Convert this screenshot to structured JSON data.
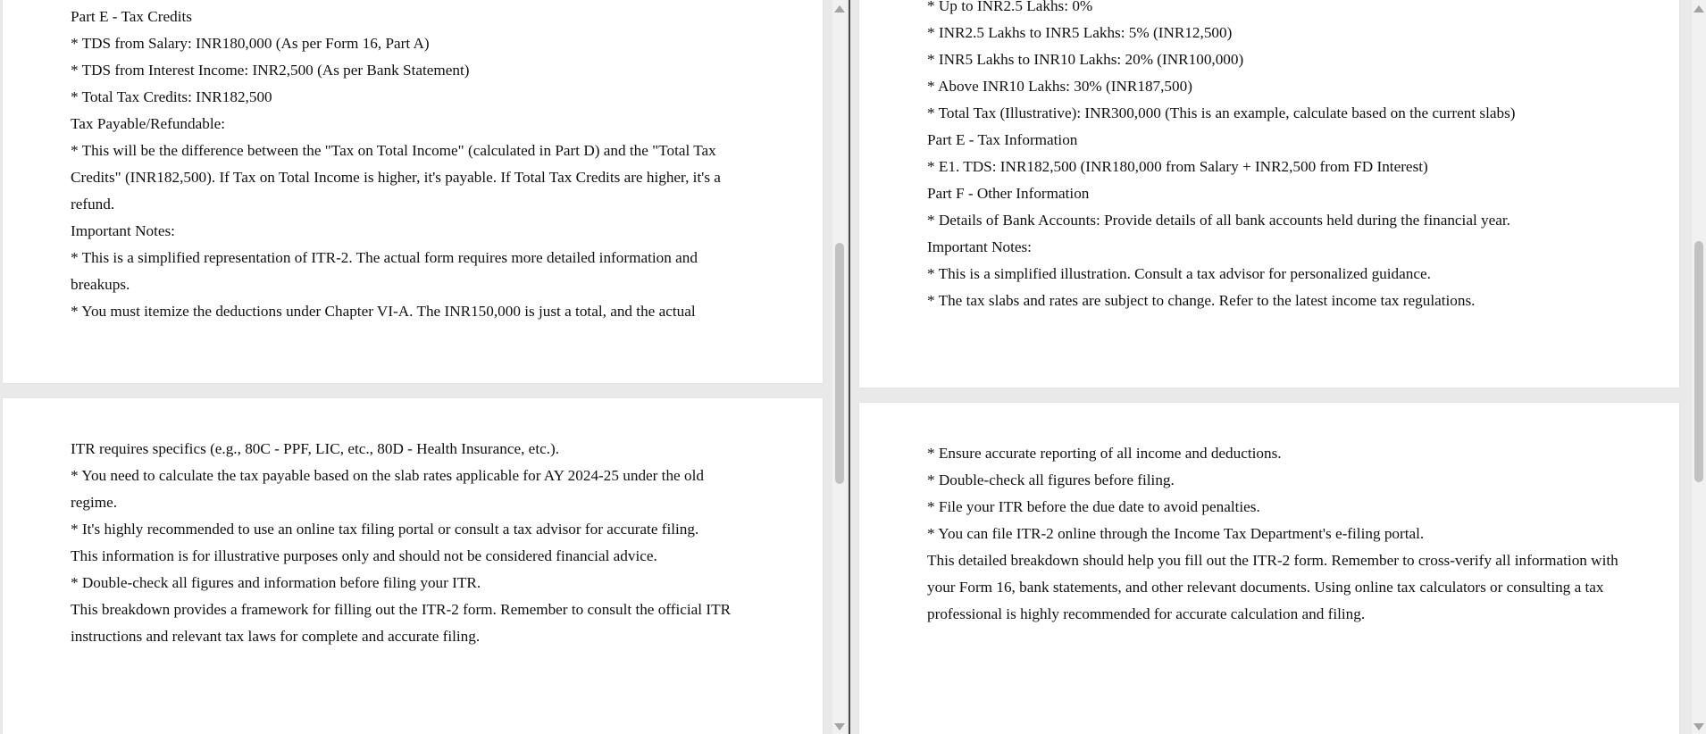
{
  "left_document": {
    "page1_lines": [
      "Part E - Tax Credits",
      "* TDS from Salary: INR180,000 (As per Form 16, Part A)",
      "* TDS from Interest Income: INR2,500 (As per Bank Statement)",
      "* Total Tax Credits: INR182,500",
      "Tax Payable/Refundable:",
      "* This will be the difference between the \"Tax on Total Income\" (calculated in Part D) and the \"Total Tax Credits\" (INR182,500). If Tax on Total Income is higher, it's payable. If Total Tax Credits are higher, it's a refund.",
      "Important Notes:",
      "* This is a simplified representation of ITR-2. The actual form requires more detailed information and breakups.",
      "* You must itemize the deductions under Chapter VI-A. The INR150,000 is just a total, and the actual"
    ],
    "page2_lines": [
      "ITR requires specifics (e.g., 80C - PPF, LIC, etc., 80D - Health Insurance, etc.).",
      "* You need to calculate the tax payable based on the slab rates applicable for AY 2024-25 under the old regime.",
      "* It's highly recommended to use an online tax filing portal or consult a tax advisor for accurate filing.",
      "This information is for illustrative purposes only and should not be considered financial advice.",
      "* Double-check all figures and information before filing your ITR.",
      "This breakdown provides a framework for filling out the ITR-2 form. Remember to consult the official ITR instructions and relevant tax laws for complete and accurate filing."
    ]
  },
  "right_document": {
    "page1_lines": [
      "* Up to INR2.5 Lakhs: 0%",
      "* INR2.5 Lakhs to INR5 Lakhs: 5% (INR12,500)",
      "* INR5 Lakhs to INR10 Lakhs: 20% (INR100,000)",
      "* Above INR10 Lakhs: 30% (INR187,500)",
      "* Total Tax (Illustrative): INR300,000 (This is an example, calculate based on the current slabs)",
      "Part E - Tax Information",
      "* E1. TDS: INR182,500 (INR180,000 from Salary + INR2,500 from FD Interest)",
      "Part F - Other Information",
      "* Details of Bank Accounts: Provide details of all bank accounts held during the financial year.",
      "Important Notes:",
      "* This is a simplified illustration. Consult a tax advisor for personalized guidance.",
      "* The tax slabs and rates are subject to change. Refer to the latest income tax regulations."
    ],
    "page2_lines": [
      "* Ensure accurate reporting of all income and deductions.",
      "* Double-check all figures before filing.",
      "* File your ITR before the due date to avoid penalties.",
      "* You can file ITR-2 online through the Income Tax Department's e-filing portal.",
      "This detailed breakdown should help you fill out the ITR-2 form. Remember to cross-verify all information with your Form 16, bank statements, and other relevant documents. Using online tax calculators or consulting a tax professional is highly recommended for accurate calculation and filing."
    ]
  },
  "icons": {
    "scroll_up": "chevron-up-icon",
    "scroll_down": "chevron-down-icon"
  }
}
